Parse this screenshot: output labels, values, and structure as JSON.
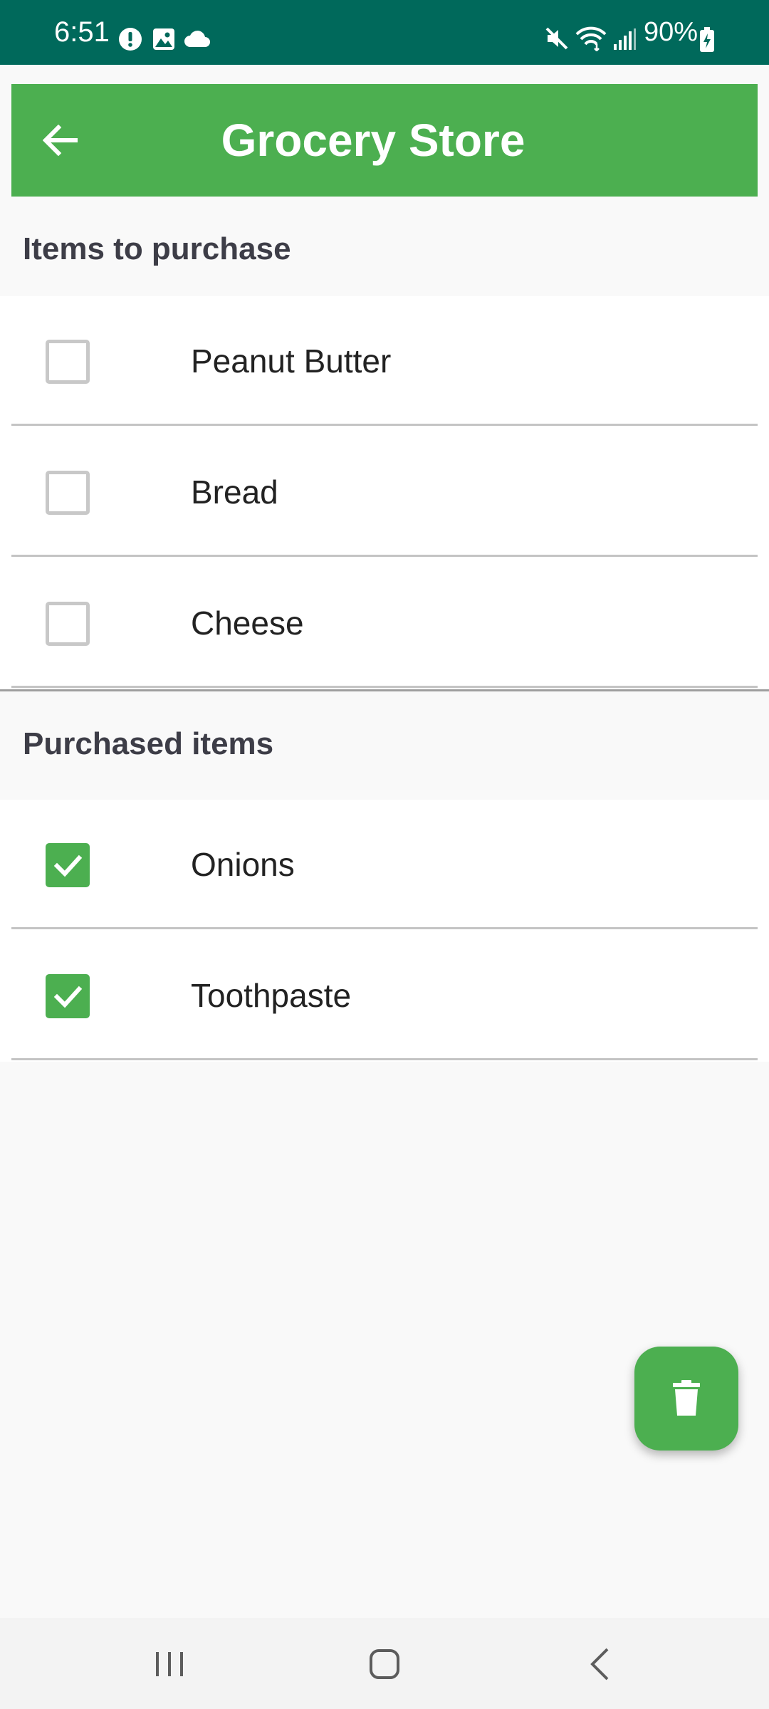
{
  "status_bar": {
    "time": "6:51",
    "battery": "90%",
    "left_icons": [
      "alert-icon",
      "image-icon",
      "cloud-icon"
    ],
    "right_icons": [
      "mute-icon",
      "wifi-icon",
      "signal-icon",
      "battery-icon"
    ]
  },
  "app_bar": {
    "title": "Grocery Store",
    "back_icon": "arrow-left-icon"
  },
  "sections": {
    "to_purchase": {
      "header": "Items to purchase",
      "items": [
        {
          "label": "Peanut Butter",
          "checked": false
        },
        {
          "label": "Bread",
          "checked": false
        },
        {
          "label": "Cheese",
          "checked": false
        }
      ]
    },
    "purchased": {
      "header": "Purchased items",
      "items": [
        {
          "label": "Onions",
          "checked": true
        },
        {
          "label": "Toothpaste",
          "checked": true
        }
      ]
    }
  },
  "fab": {
    "icon": "trash-icon"
  },
  "nav_bar": {
    "buttons": [
      "recent-apps-icon",
      "home-icon",
      "back-icon"
    ]
  },
  "colors": {
    "status_bar": "#00695b",
    "accent": "#4caf50",
    "text": "#222222",
    "header_text": "#3d3d47"
  }
}
